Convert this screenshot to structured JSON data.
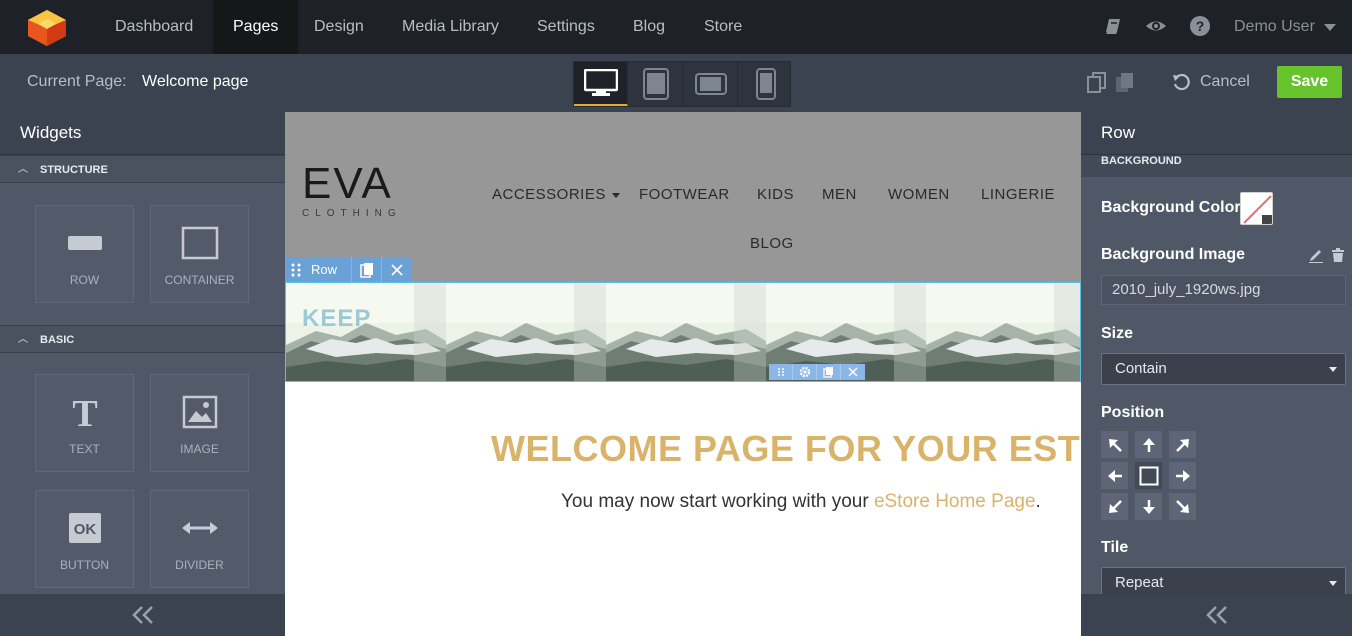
{
  "topnav": {
    "items": [
      "Dashboard",
      "Pages",
      "Design",
      "Media Library",
      "Settings",
      "Blog",
      "Store"
    ],
    "active": "Pages",
    "user": "Demo User"
  },
  "subbar": {
    "current_page_label": "Current Page:",
    "current_page_value": "Welcome page",
    "cancel_label": "Cancel",
    "save_label": "Save"
  },
  "widgets_panel": {
    "title": "Widgets",
    "structure_label": "STRUCTURE",
    "basic_label": "BASIC",
    "structure_items": [
      {
        "label": "ROW",
        "icon": "row-icon"
      },
      {
        "label": "CONTAINER",
        "icon": "container-icon"
      }
    ],
    "basic_items": [
      {
        "label": "TEXT",
        "icon": "text-icon"
      },
      {
        "label": "IMAGE",
        "icon": "image-icon"
      },
      {
        "label": "BUTTON",
        "icon": "button-icon",
        "glyph": "OK"
      },
      {
        "label": "DIVIDER",
        "icon": "divider-icon"
      }
    ]
  },
  "canvas": {
    "brand": "EVA",
    "brand_sub": "CLOTHING",
    "nav": [
      "ACCESSORIES",
      "FOOTWEAR",
      "KIDS",
      "MEN",
      "WOMEN",
      "LINGERIE",
      "BLOG"
    ],
    "row_toolbar_label": "Row",
    "banner_text": "KEEP",
    "welcome_title": "WELCOME PAGE FOR YOUR ESTO",
    "welcome_sub_prefix": "You may now start working with your ",
    "welcome_sub_link": "eStore Home Page",
    "welcome_sub_suffix": "."
  },
  "row_panel": {
    "title": "Row",
    "section": "BACKGROUND",
    "bg_color_label": "Background Color",
    "bg_image_label": "Background Image",
    "bg_image_value": "2010_july_1920ws.jpg",
    "size_label": "Size",
    "size_value": "Contain",
    "position_label": "Position",
    "tile_label": "Tile",
    "tile_value": "Repeat"
  },
  "colors": {
    "save": "#66c32b",
    "accent_gold": "#d9b36a",
    "selection_blue": "#6aa1d6"
  }
}
